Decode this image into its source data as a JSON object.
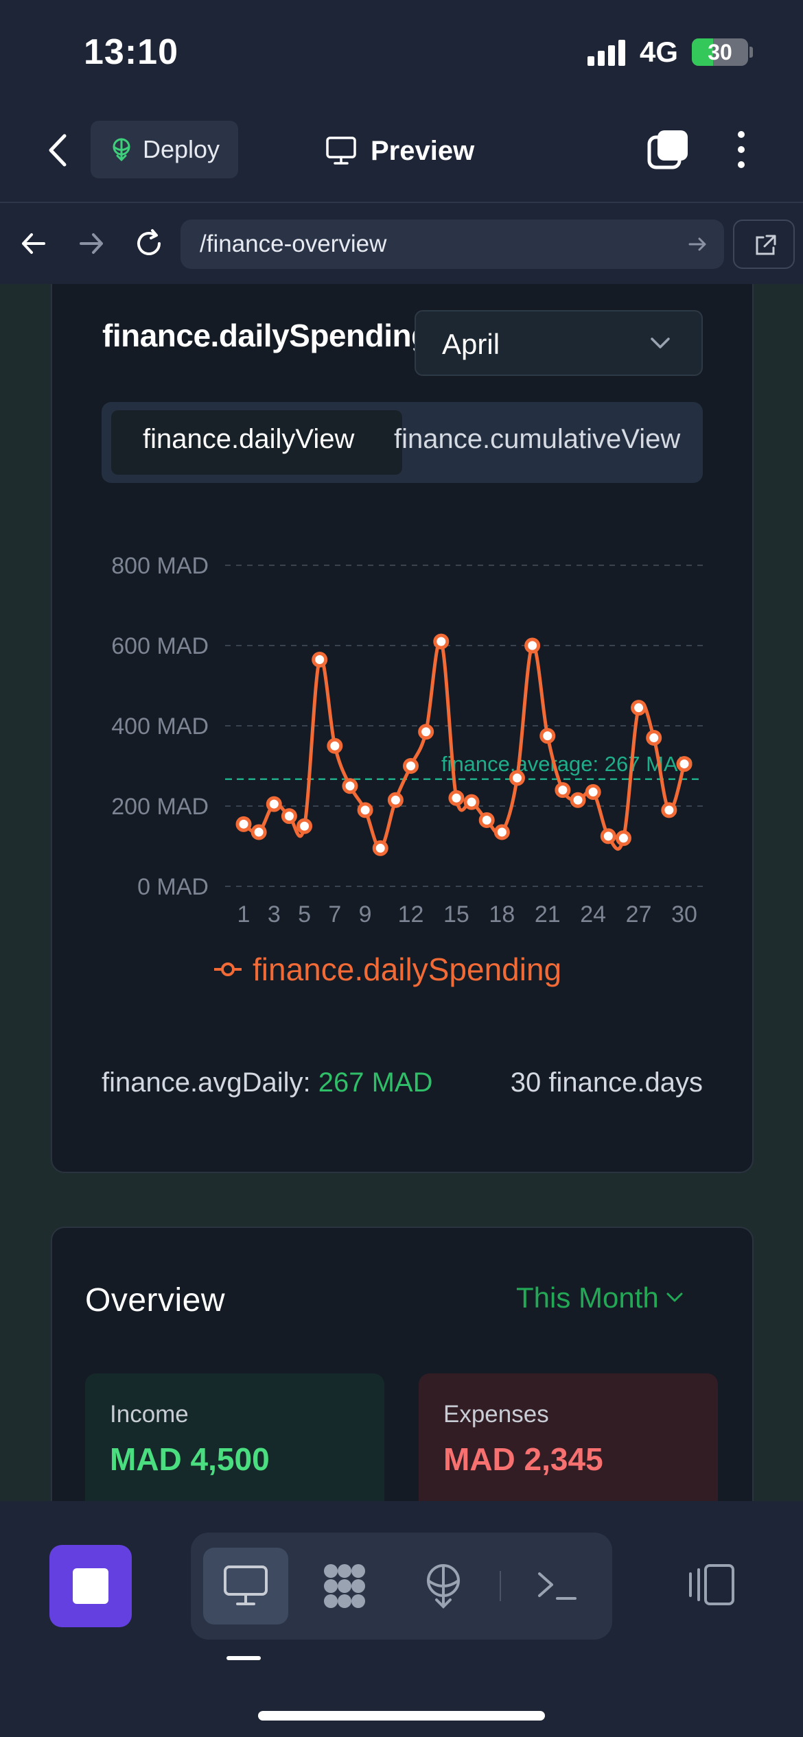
{
  "status_bar": {
    "time": "13:10",
    "network": "4G",
    "battery": "30"
  },
  "header": {
    "deploy_label": "Deploy",
    "preview_label": "Preview"
  },
  "browser": {
    "url": "/finance-overview"
  },
  "daily_card": {
    "title": "finance.dailySpending",
    "month": "April",
    "tabs": [
      "finance.dailyView",
      "finance.cumulativeView"
    ],
    "active_tab": 0,
    "legend": "finance.dailySpending",
    "avg_label": "finance.avgDaily:",
    "avg_value": "267 MAD",
    "days_label": "30 finance.days"
  },
  "chart_data": {
    "type": "line",
    "x": [
      1,
      2,
      3,
      4,
      5,
      6,
      7,
      8,
      9,
      10,
      11,
      12,
      13,
      14,
      15,
      16,
      17,
      18,
      19,
      20,
      21,
      22,
      23,
      24,
      25,
      26,
      27,
      28,
      29,
      30
    ],
    "xticks": [
      "1",
      "3",
      "5",
      "7",
      "9",
      "12",
      "15",
      "18",
      "21",
      "24",
      "27",
      "30"
    ],
    "xtick_values": [
      1,
      3,
      5,
      7,
      9,
      12,
      15,
      18,
      21,
      24,
      27,
      30
    ],
    "series": [
      {
        "name": "finance.dailySpending",
        "color": "#f26b36",
        "values": [
          155,
          135,
          205,
          175,
          150,
          565,
          350,
          250,
          190,
          95,
          215,
          300,
          385,
          610,
          220,
          210,
          165,
          135,
          270,
          600,
          375,
          240,
          215,
          235,
          125,
          120,
          445,
          370,
          190,
          305
        ]
      }
    ],
    "ylim": [
      0,
      800
    ],
    "yticks": [
      0,
      200,
      400,
      600,
      800
    ],
    "ytick_labels": [
      "0 MAD",
      "200 MAD",
      "400 MAD",
      "600 MAD",
      "800 MAD"
    ],
    "reference_line": {
      "value": 267,
      "label": "finance.average: 267 MAD",
      "color": "#1fae8a"
    },
    "grid": true,
    "legend_position": "bottom"
  },
  "overview": {
    "title": "Overview",
    "period": "This Month",
    "income_label": "Income",
    "income_value": "MAD 4,500",
    "expenses_label": "Expenses",
    "expenses_value": "MAD 2,345"
  },
  "colors": {
    "accent": "#6440e0",
    "income": "#4ade80",
    "expense": "#f87171",
    "line": "#f26b36"
  }
}
